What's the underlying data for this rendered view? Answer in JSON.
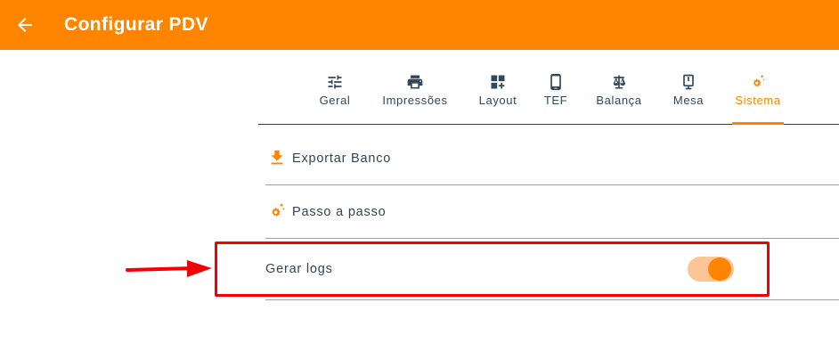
{
  "appbar": {
    "title": "Configurar PDV",
    "back_icon": "arrow-left-icon",
    "color": "#ff8400"
  },
  "tabs": [
    {
      "label": "Geral",
      "icon": "sliders-icon",
      "active": false
    },
    {
      "label": "Impressões",
      "icon": "printer-icon",
      "active": false
    },
    {
      "label": "Layout",
      "icon": "layout-plus-icon",
      "active": false
    },
    {
      "label": "TEF",
      "icon": "phone-icon",
      "active": false
    },
    {
      "label": "Balança",
      "icon": "scale-icon",
      "active": false
    },
    {
      "label": "Mesa",
      "icon": "tablet-stand-icon",
      "active": false
    },
    {
      "label": "Sistema",
      "icon": "gear-sparkle-icon",
      "active": true
    }
  ],
  "sistema": {
    "exportar": {
      "label": "Exportar Banco",
      "icon": "download-icon"
    },
    "passo": {
      "label": "Passo a passo",
      "icon": "gear-sparkle-icon"
    },
    "logs": {
      "label": "Gerar logs",
      "enabled": true
    }
  },
  "annotation": {
    "highlight_color": "#f40000",
    "arrow_icon": "arrow-right-icon"
  }
}
